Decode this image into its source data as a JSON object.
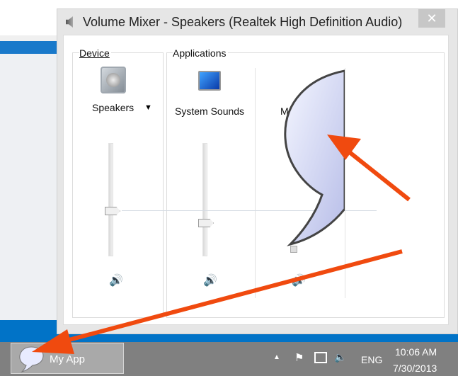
{
  "window": {
    "title": "Volume Mixer - Speakers (Realtek High Definition Audio)",
    "close": "✕"
  },
  "device": {
    "group_label": "Device",
    "name": "Speakers",
    "dropdown": "▼",
    "volume_percent": 40
  },
  "applications": {
    "group_label": "Applications",
    "items": [
      {
        "name": "System Sounds",
        "volume_percent": 30
      },
      {
        "name": "M",
        "volume_percent": 3
      }
    ]
  },
  "taskbar": {
    "app_label": "My App",
    "language": "ENG",
    "time": "10:06 AM",
    "date": "7/30/2013"
  },
  "colors": {
    "accent": "#0173c7",
    "arrow": "#f04a0f"
  }
}
